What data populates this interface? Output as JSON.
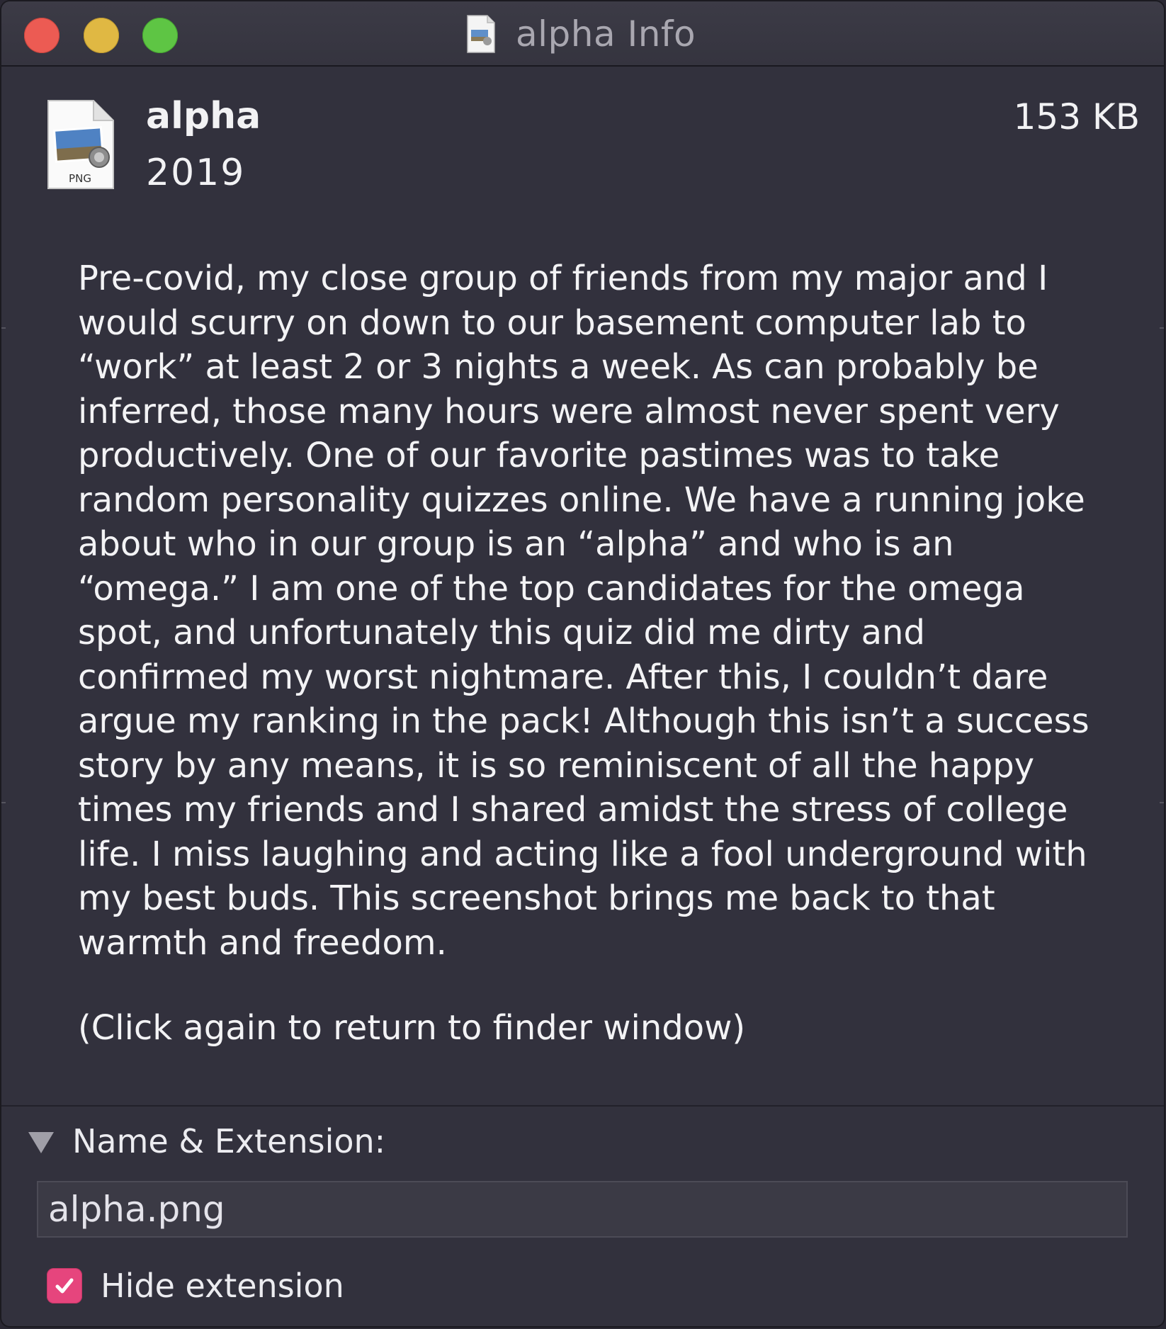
{
  "window": {
    "title": "alpha Info"
  },
  "file": {
    "name": "alpha",
    "year": "2019",
    "size": "153 KB",
    "type_label": "PNG",
    "icon": "png-file-icon"
  },
  "comment": {
    "body": "Pre-covid, my close group of friends from my major and I would scurry on down to our basement computer lab to “work” at least 2 or 3 nights a week. As can probably be inferred, those many hours were almost never spent very productively. One of our favorite pastimes was to take random personality quizzes online. We have a running joke about who in our group is an “alpha” and who is an “omega.” I am one of the top candidates for the omega spot, and unfortunately this quiz did me dirty and confirmed my worst nightmare. After this, I couldn’t dare argue my ranking in the pack! Although this isn’t a success story by any means, it is so reminiscent of all the happy times my friends and I shared amidst the stress of college life. I miss laughing and acting like a fool underground with my best buds. This screenshot brings me back to that warmth and freedom.",
    "hint": "(Click again to return to finder window)"
  },
  "name_extension": {
    "section_title": "Name & Extension:",
    "field_value": "alpha.png",
    "hide_extension_label": "Hide extension",
    "hide_extension_checked": true
  },
  "colors": {
    "close": "#ec5b53",
    "minimize": "#e0b843",
    "maximize": "#5ec544",
    "checkbox_accent": "#e6457d",
    "background": "#32313d"
  }
}
